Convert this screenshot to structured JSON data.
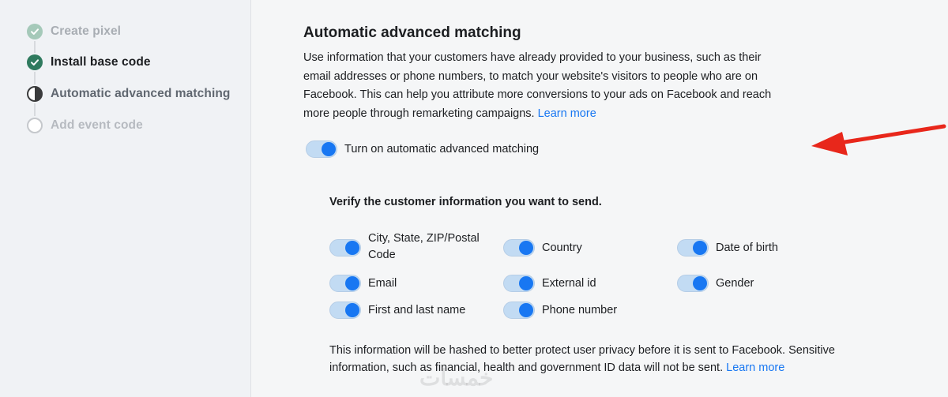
{
  "sidebar": {
    "steps": [
      {
        "label": "Create pixel",
        "state": "done-faded"
      },
      {
        "label": "Install base code",
        "state": "done"
      },
      {
        "label": "Automatic advanced matching",
        "state": "current"
      },
      {
        "label": "Add event code",
        "state": "pending"
      }
    ]
  },
  "main": {
    "title": "Automatic advanced matching",
    "description": "Use information that your customers have already provided to your business, such as their email addresses or phone numbers, to match your website's visitors to people who are on Facebook. This can help you attribute more conversions to your ads on Facebook and reach more people through remarketing campaigns.",
    "learn_more": "Learn more",
    "toggle_label": "Turn on automatic advanced matching",
    "toggle_on": true,
    "verify_title": "Verify the customer information you want to send.",
    "options": [
      {
        "label": "City, State, ZIP/Postal Code",
        "on": true
      },
      {
        "label": "Country",
        "on": true
      },
      {
        "label": "Date of birth",
        "on": true
      },
      {
        "label": "Email",
        "on": true
      },
      {
        "label": "External id",
        "on": true
      },
      {
        "label": "Gender",
        "on": true
      },
      {
        "label": "First and last name",
        "on": true
      },
      {
        "label": "Phone number",
        "on": true
      }
    ],
    "footer": "This information will be hashed to better protect user privacy before it is sent to Facebook. Sensitive information, such as financial, health and government ID data will not be sent.",
    "footer_learn_more": "Learn more"
  },
  "colors": {
    "accent": "#1877f2",
    "toggle_track": "#c2dbf3",
    "step_done": "#2f7a5e",
    "arrow": "#e8271b"
  },
  "watermark": "خمسات"
}
